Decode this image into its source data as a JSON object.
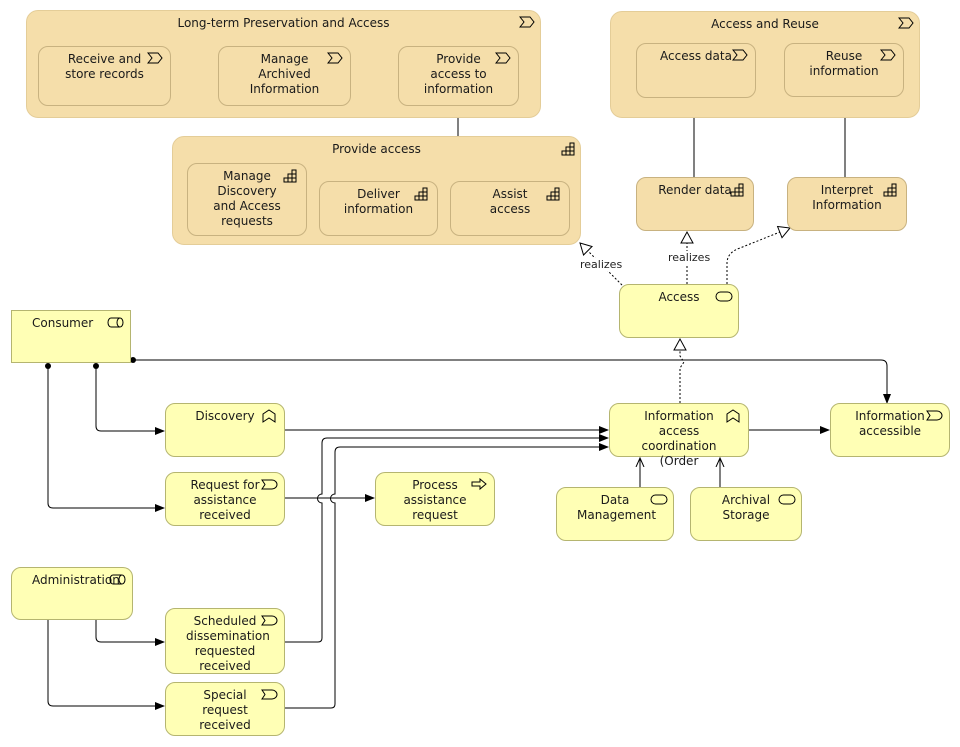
{
  "groups": {
    "preservation": {
      "label": "Long-term Preservation and Access",
      "icon": "value-stream-icon"
    },
    "reuse": {
      "label": "Access and Reuse",
      "icon": "value-stream-icon"
    },
    "provide_access": {
      "label": "Provide access",
      "icon": "capability-icon"
    }
  },
  "nodes": {
    "receive": "Receive and store records",
    "manage_archived": "Manage Archived Information",
    "provide_info": "Provide access to information",
    "access_data": "Access data",
    "reuse_info": "Reuse information",
    "manage_discovery": "Manage Discovery and Access requests",
    "deliver": "Deliver information",
    "assist": "Assist access",
    "render": "Render data",
    "interpret": "Interpret Information",
    "access": "Access",
    "consumer": "Consumer",
    "discovery": "Discovery",
    "coordination": "Information access coordination (Order",
    "accessible": "Information accessible",
    "request_assist": "Request for assistance received",
    "process_assist": "Process assistance request",
    "data_mgmt": "Data Management",
    "archival": "Archival Storage",
    "administration": "Administration",
    "scheduled": "Scheduled dissemination requested received",
    "special": "Special request received"
  },
  "edge_labels": {
    "realizes1": "realizes",
    "realizes2": "realizes"
  },
  "colors": {
    "business": "#ffffb5",
    "strategy": "#f5deaa"
  }
}
